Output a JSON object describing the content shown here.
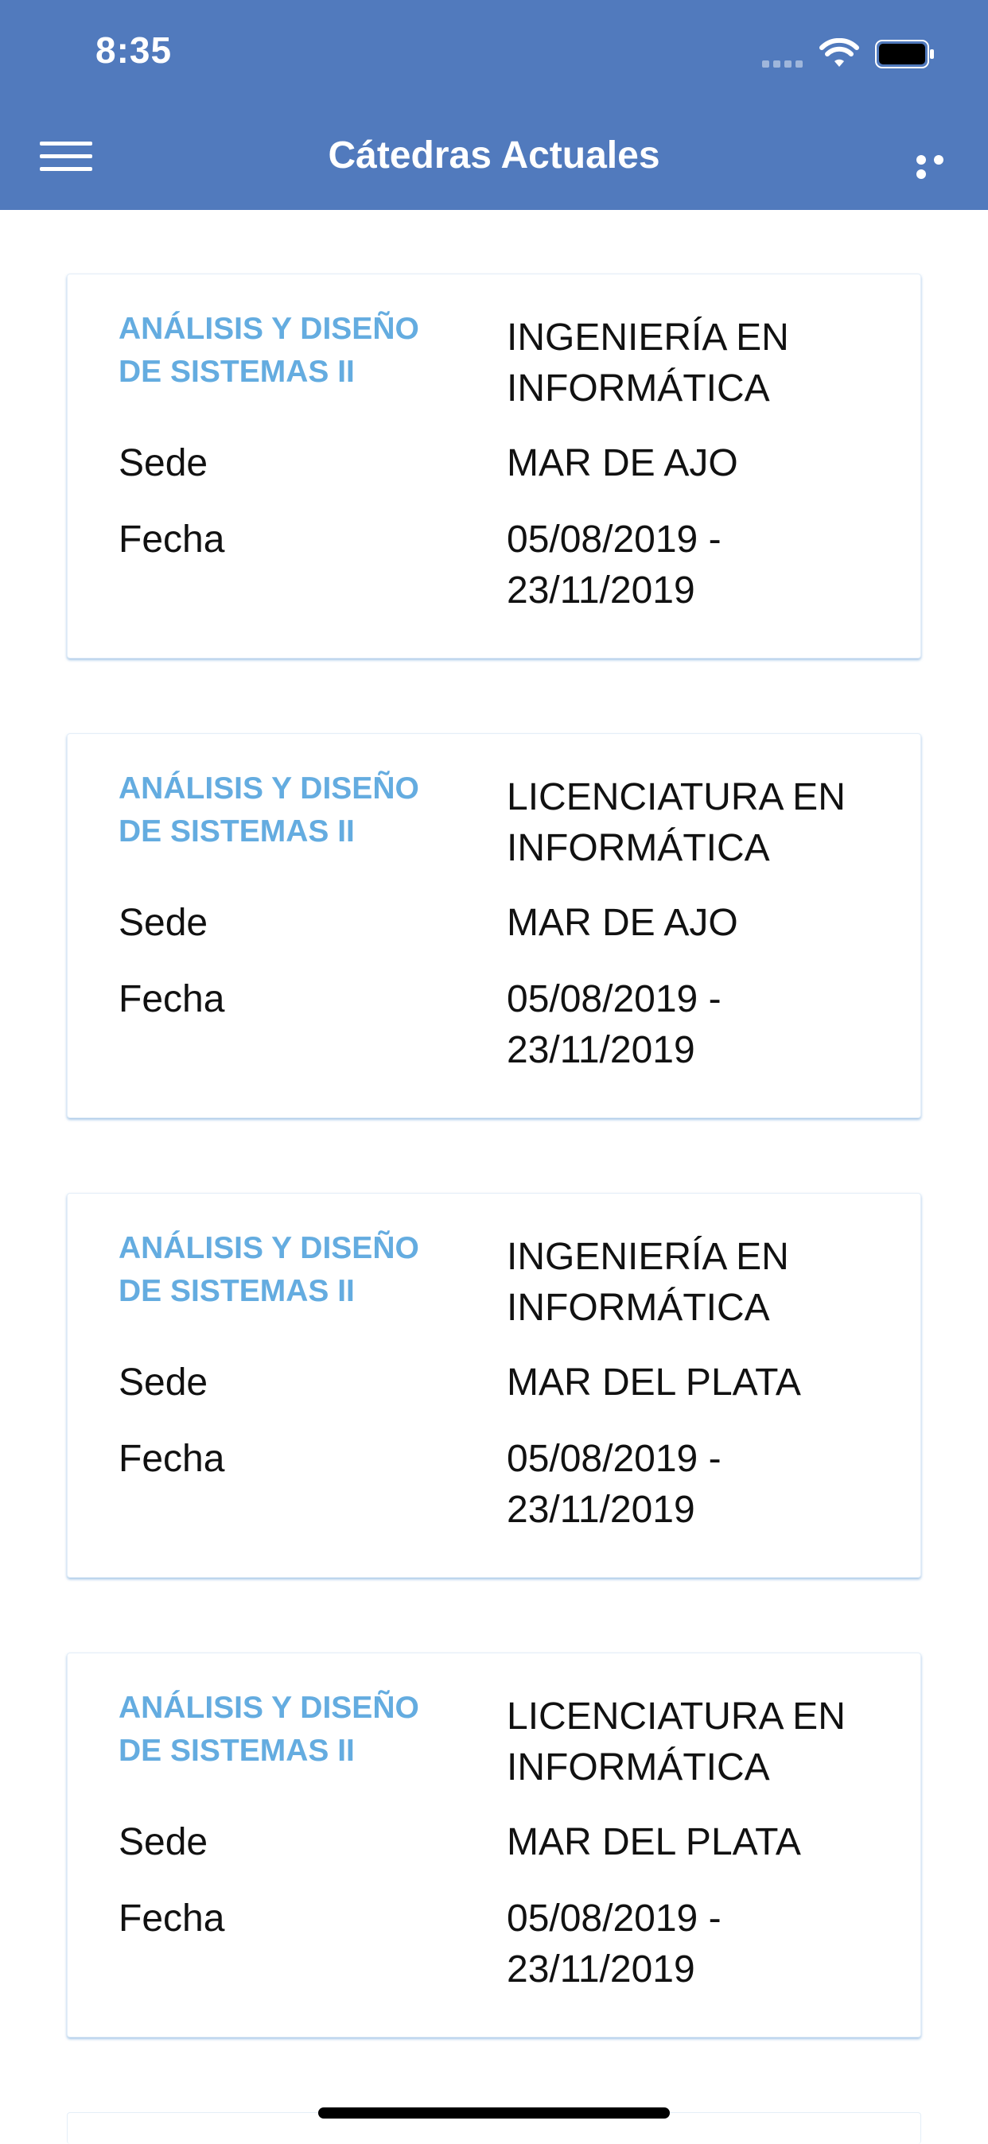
{
  "status_bar": {
    "time": "8:35"
  },
  "header": {
    "title": "Cátedras Actuales"
  },
  "cards": [
    {
      "subject": "ANÁLISIS Y DISEÑO DE SISTEMAS II",
      "career": "INGENIERÍA EN INFORMÁTICA",
      "sede_label": "Sede",
      "sede": "MAR DE AJO",
      "fecha_label": "Fecha",
      "fecha": "05/08/2019 - 23/11/2019"
    },
    {
      "subject": "ANÁLISIS Y DISEÑO DE SISTEMAS II",
      "career": "LICENCIATURA EN INFORMÁTICA",
      "sede_label": "Sede",
      "sede": "MAR DE AJO",
      "fecha_label": "Fecha",
      "fecha": "05/08/2019 - 23/11/2019"
    },
    {
      "subject": "ANÁLISIS Y DISEÑO DE SISTEMAS II",
      "career": "INGENIERÍA EN INFORMÁTICA",
      "sede_label": "Sede",
      "sede": "MAR DEL PLATA",
      "fecha_label": "Fecha",
      "fecha": "05/08/2019 - 23/11/2019"
    },
    {
      "subject": "ANÁLISIS Y DISEÑO DE SISTEMAS II",
      "career": "LICENCIATURA EN INFORMÁTICA",
      "sede_label": "Sede",
      "sede": "MAR DEL PLATA",
      "fecha_label": "Fecha",
      "fecha": "05/08/2019 - 23/11/2019"
    }
  ],
  "icons": {
    "menu": "menu-icon",
    "more": "more-icon",
    "wifi": "wifi-icon",
    "battery": "battery-icon",
    "signal": "signal-icon"
  },
  "colors": {
    "header_bg": "#517abd",
    "subject_text": "#64ace0"
  }
}
